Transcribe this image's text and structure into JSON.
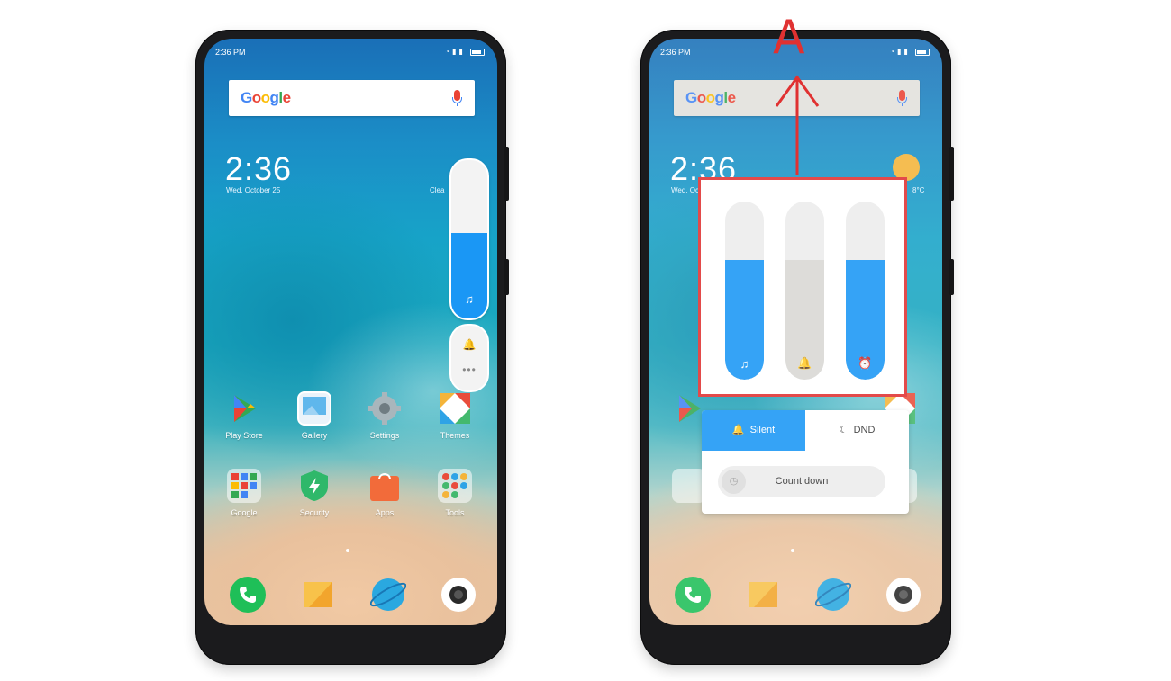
{
  "status_bar": {
    "time": "2:36 PM"
  },
  "search_widget": {
    "logo_text": "Google",
    "logo_letters": [
      "G",
      "o",
      "o",
      "g",
      "l",
      "e"
    ]
  },
  "clock_widget": {
    "time": "2:36",
    "date": "Wed, October 25",
    "weather_left": "Clea",
    "weather_right": "8°C"
  },
  "apps_row_1": [
    {
      "label": "Play Store",
      "icon": "play-store-icon"
    },
    {
      "label": "Gallery",
      "icon": "gallery-icon"
    },
    {
      "label": "Settings",
      "icon": "settings-icon"
    },
    {
      "label": "Themes",
      "icon": "themes-icon"
    }
  ],
  "apps_row_2": [
    {
      "label": "Google",
      "icon": "google-folder-icon"
    },
    {
      "label": "Security",
      "icon": "security-icon"
    },
    {
      "label": "Apps",
      "icon": "apps-icon"
    },
    {
      "label": "Tools",
      "icon": "tools-folder-icon"
    }
  ],
  "dock": [
    "phone-icon",
    "messages-icon",
    "browser-icon",
    "camera-icon"
  ],
  "volume_popup": {
    "media_level": 0.54,
    "media_symbol": "♫",
    "ringer_symbol": "🔔",
    "more_symbol": "•••"
  },
  "volume_panel": {
    "sliders": [
      {
        "name": "media",
        "level": 0.67,
        "color": "#1a97f5",
        "symbol": "♫"
      },
      {
        "name": "ringer",
        "level": 0.67,
        "color": "#d9d8d4",
        "symbol": "🔔"
      },
      {
        "name": "alarm",
        "level": 0.67,
        "color": "#1a97f5",
        "symbol": "⏰"
      }
    ]
  },
  "mode_panel": {
    "silent_label": "Silent",
    "dnd_label": "DND",
    "countdown_label": "Count down"
  },
  "annotation": {
    "letter": "A",
    "color": "#e03131"
  },
  "colors": {
    "accent": "#1a97f5",
    "annotation_red": "#e03131"
  }
}
